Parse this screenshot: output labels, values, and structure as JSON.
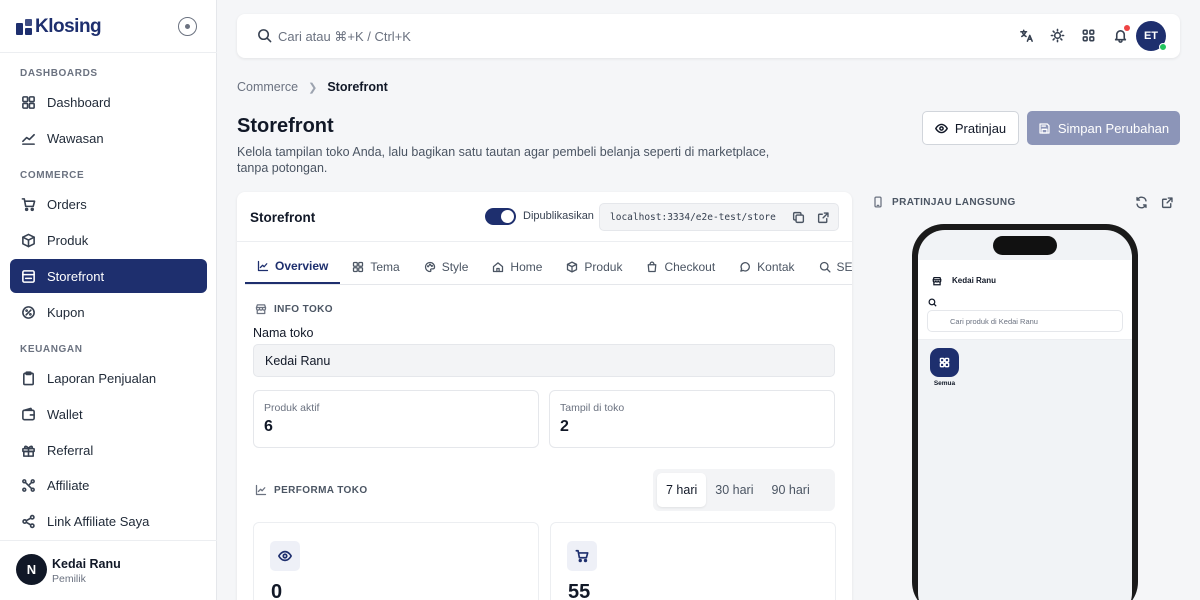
{
  "brand": {
    "name": "Klosing"
  },
  "sidebar": {
    "sections": {
      "dashboards": "DASHBOARDS",
      "commerce": "COMMERCE",
      "keuangan": "KEUANGAN"
    },
    "items": [
      {
        "label": "Dashboard",
        "icon": "grid-icon"
      },
      {
        "label": "Wawasan",
        "icon": "trend-icon"
      },
      {
        "label": "Orders",
        "icon": "cart-icon"
      },
      {
        "label": "Produk",
        "icon": "box-icon"
      },
      {
        "label": "Storefront",
        "icon": "store-icon",
        "active": true
      },
      {
        "label": "Kupon",
        "icon": "coupon-icon"
      },
      {
        "label": "Laporan Penjualan",
        "icon": "clipboard-icon"
      },
      {
        "label": "Wallet",
        "icon": "wallet-icon"
      },
      {
        "label": "Referral",
        "icon": "gift-icon"
      },
      {
        "label": "Affiliate",
        "icon": "network-icon"
      },
      {
        "label": "Link Affiliate Saya",
        "icon": "share-icon"
      }
    ],
    "user": {
      "initial": "N",
      "name": "Kedai Ranu",
      "role": "Pemilik"
    }
  },
  "topbar": {
    "search_placeholder": "Cari atau ⌘+K / Ctrl+K",
    "avatar": "ET"
  },
  "breadcrumb": {
    "parent": "Commerce",
    "current": "Storefront"
  },
  "header": {
    "title": "Storefront",
    "description": "Kelola tampilan toko Anda, lalu bagikan satu tautan agar pembeli belanja seperti di marketplace, tanpa potongan.",
    "preview_label": "Pratinjau",
    "save_label": "Simpan Perubahan"
  },
  "card": {
    "title": "Storefront",
    "publish_label": "Dipublikasikan",
    "url": "localhost:3334/e2e-test/store",
    "tabs": [
      "Overview",
      "Tema",
      "Style",
      "Home",
      "Produk",
      "Checkout",
      "Kontak",
      "SEO"
    ],
    "info_heading": "INFO TOKO",
    "store_name_label": "Nama toko",
    "store_name_value": "Kedai Ranu",
    "stats": [
      {
        "label": "Produk aktif",
        "value": "6"
      },
      {
        "label": "Tampil di toko",
        "value": "2"
      }
    ],
    "performance_heading": "PERFORMA TOKO",
    "ranges": [
      "7 hari",
      "30 hari",
      "90 hari"
    ],
    "metrics": [
      {
        "icon": "eye-icon",
        "value": "0"
      },
      {
        "icon": "cart-icon",
        "value": "55"
      }
    ]
  },
  "live_preview": {
    "heading": "PRATINJAU LANGSUNG",
    "store_name": "Kedai Ranu",
    "search_placeholder": "Cari produk di Kedai Ranu",
    "category_label": "Semua"
  },
  "colors": {
    "primary": "#1e2f6e",
    "save_disabled": "#8c95b8",
    "notification": "#ef4444",
    "online": "#22c55e"
  }
}
